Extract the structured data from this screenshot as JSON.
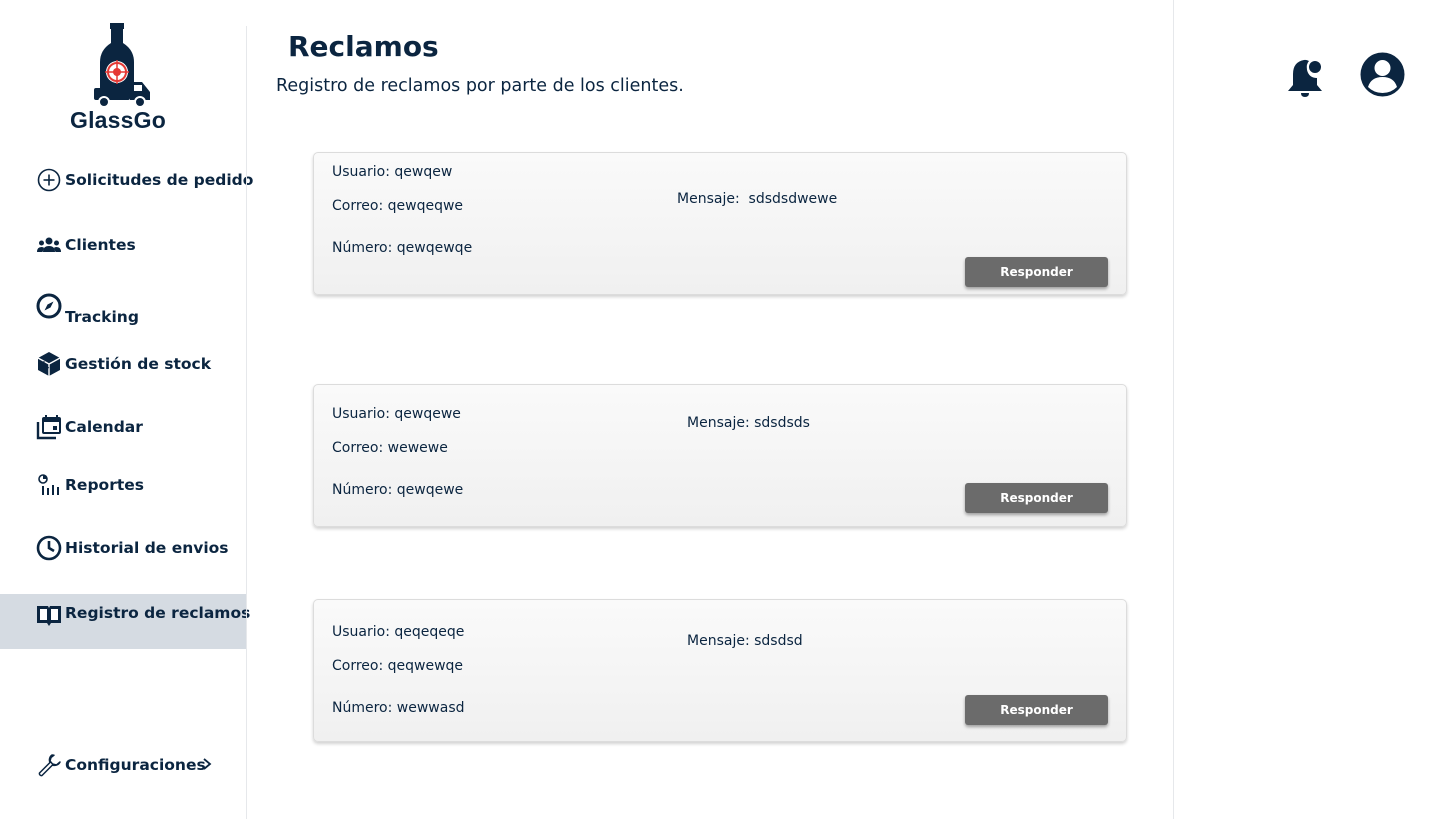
{
  "app": {
    "brand": "GlassGo"
  },
  "sidebar": {
    "items": [
      {
        "label": "Solicitudes de pedido",
        "icon": "plus-circle-icon"
      },
      {
        "label": "Clientes",
        "icon": "people-icon"
      },
      {
        "label": "Tracking",
        "icon": "compass-icon"
      },
      {
        "label": "Gestión de stock",
        "icon": "box-icon"
      },
      {
        "label": "Calendar",
        "icon": "calendar-icon"
      },
      {
        "label": "Reportes",
        "icon": "reports-icon"
      },
      {
        "label": "Historial de envios",
        "icon": "clock-icon"
      },
      {
        "label": "Registro de reclamos",
        "icon": "book-icon",
        "active": true
      }
    ],
    "settings": {
      "label": "Configuraciones",
      "icon": "wrench-icon"
    }
  },
  "header": {
    "title": "Reclamos",
    "subtitle": "Registro de reclamos por parte de los clientes."
  },
  "claims": [
    {
      "usuario": "Usuario: qewqew",
      "correo": "Correo: qewqeqwe",
      "numero": "Número: qewqewqe",
      "mensaje": "Mensaje:  sdsdsdwewe",
      "button": "Responder"
    },
    {
      "usuario": "Usuario: qewqewe",
      "correo": "Correo: wewewe",
      "numero": "Número: qewqewe",
      "mensaje": "Mensaje: sdsdsds",
      "button": "Responder"
    },
    {
      "usuario": "Usuario: qeqeqeqe",
      "correo": "Correo: qeqwewqe",
      "numero": "Número: wewwasd",
      "mensaje": "Mensaje: sdsdsd",
      "button": "Responder"
    }
  ],
  "topbar": {
    "icons": [
      "notification-bell-icon",
      "user-account-icon"
    ]
  },
  "colors": {
    "primary": "#0b2540",
    "active_bg": "#d5dbe2",
    "button_bg": "#6b6b6b",
    "logo_accent": "#e53935"
  }
}
